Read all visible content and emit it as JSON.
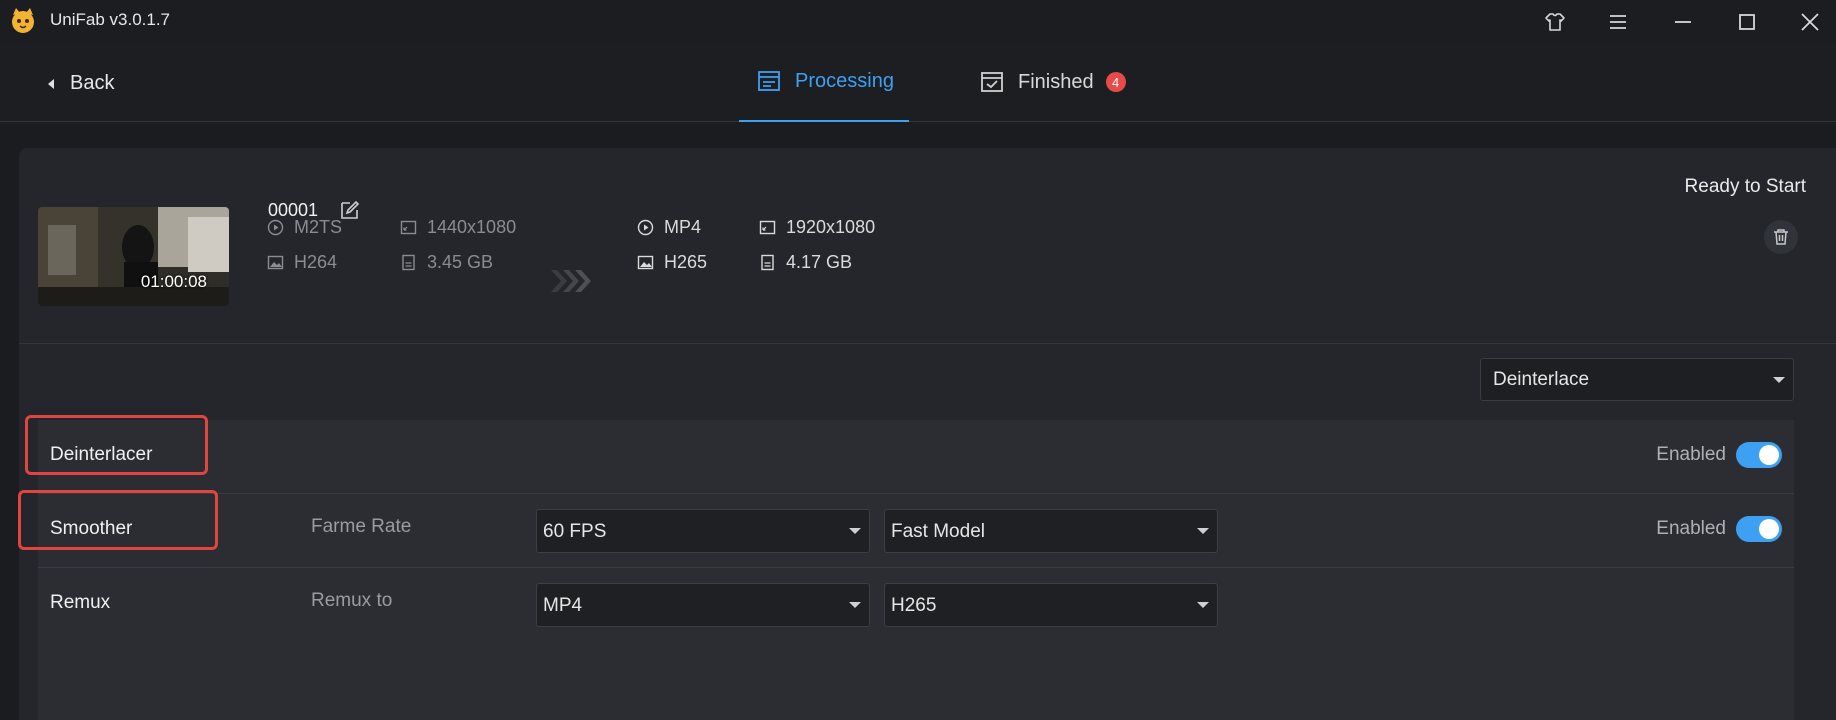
{
  "window": {
    "title": "UniFab v3.0.1.7"
  },
  "nav": {
    "back_label": "Back",
    "tabs": [
      {
        "label": "Processing",
        "active": true
      },
      {
        "label": "Finished",
        "badge": "4"
      }
    ]
  },
  "task": {
    "name": "00001",
    "duration": "01:00:08",
    "status": "Ready to Start",
    "source": {
      "container": "M2TS",
      "resolution": "1440x1080",
      "codec": "H264",
      "size": "3.45 GB"
    },
    "output": {
      "container": "MP4",
      "resolution": "1920x1080",
      "codec": "H265",
      "size": "4.17 GB"
    }
  },
  "mode_select": {
    "value": "Deinterlace"
  },
  "rows": {
    "deinterlacer": {
      "label": "Deinterlacer",
      "toggle_label": "Enabled"
    },
    "smoother": {
      "label": "Smoother",
      "sub_label": "Farme Rate",
      "dropdown1": "60 FPS",
      "dropdown2": "Fast Model",
      "toggle_label": "Enabled"
    },
    "remux": {
      "label": "Remux",
      "sub_label": "Remux to",
      "dropdown1": "MP4",
      "dropdown2": "H265"
    }
  },
  "colors": {
    "accent": "#3ea0f2",
    "badge": "#e84a4a",
    "highlight": "#e0453f",
    "background": "#1b1c20",
    "card": "#25262b"
  }
}
